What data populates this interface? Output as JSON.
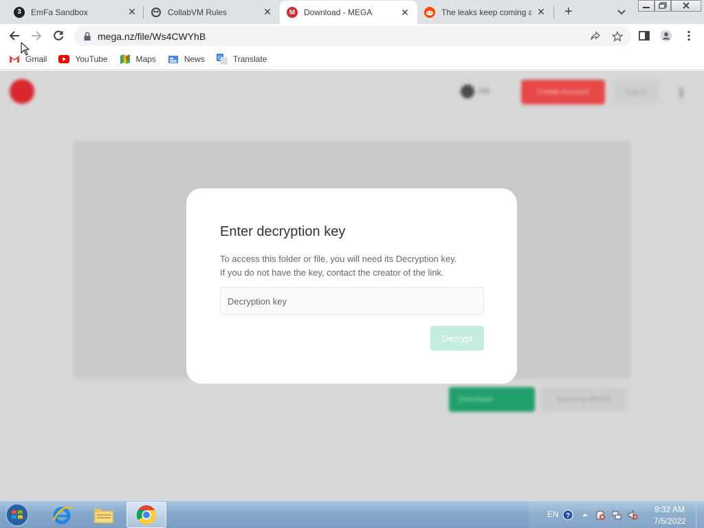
{
  "browser": {
    "tabs": [
      {
        "title": "EmFa Sandbox",
        "icon": "emfa-icon",
        "color": "#202124",
        "letter": "3",
        "active": false
      },
      {
        "title": "CollabVM Rules",
        "icon": "collabvm-icon",
        "color": "#3c4043",
        "letter": "",
        "active": false
      },
      {
        "title": "Download - MEGA",
        "icon": "mega-icon",
        "color": "#d9272e",
        "letter": "M",
        "active": true
      },
      {
        "title": "The leaks keep coming ar",
        "icon": "reddit-icon",
        "color": "#ff4500",
        "letter": "",
        "active": false
      }
    ],
    "url": "mega.nz/file/Ws4CWYhB",
    "bookmarks": [
      {
        "label": "Gmail",
        "icon": "gmail-icon"
      },
      {
        "label": "YouTube",
        "icon": "youtube-icon"
      },
      {
        "label": "Maps",
        "icon": "maps-icon"
      },
      {
        "label": "News",
        "icon": "news-icon"
      },
      {
        "label": "Translate",
        "icon": "translate-icon"
      }
    ]
  },
  "dialog": {
    "title": "Enter decryption key",
    "description_line1": "To access this folder or file, you will need its Decryption key.",
    "description_line2": "If you do not have the key, contact the creator of the link.",
    "input_placeholder": "Decryption key",
    "input_value": "",
    "decrypt_label": "Decrypt"
  },
  "background_page": {
    "theme_label": "ON",
    "create_label": "Create Account",
    "login_label": "Log in",
    "download_label": "Download",
    "import_label": "Import to MEGA"
  },
  "taskbar": {
    "language": "EN",
    "time": "9:32 AM",
    "date": "7/5/2022"
  },
  "colors": {
    "mega_red": "#d9272e",
    "mega_green": "#1fa06a",
    "decrypt_disabled": "#c4ede0"
  }
}
